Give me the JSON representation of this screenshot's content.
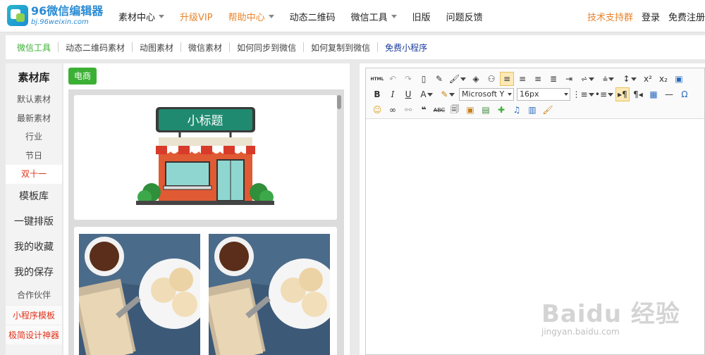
{
  "logo": {
    "title": "96微信编辑器",
    "subtitle": "bj.96weixin.com"
  },
  "topnav": {
    "items": [
      {
        "label": "素材中心",
        "dropdown": true,
        "color": "#222222"
      },
      {
        "label": "升级VIP",
        "dropdown": false,
        "color": "#e8842c"
      },
      {
        "label": "帮助中心",
        "dropdown": true,
        "color": "#e8842c"
      },
      {
        "label": "动态二维码",
        "dropdown": false,
        "color": "#222222"
      },
      {
        "label": "微信工具",
        "dropdown": true,
        "color": "#222222"
      },
      {
        "label": "旧版",
        "dropdown": false,
        "color": "#222222"
      },
      {
        "label": "问题反馈",
        "dropdown": false,
        "color": "#222222"
      }
    ],
    "right": {
      "support": "技术支持群",
      "login": "登录",
      "register": "免费注册"
    }
  },
  "subnav": {
    "items": [
      {
        "label": "微信工具",
        "color": "#3cb034"
      },
      {
        "label": "动态二维码素材",
        "color": "#444444"
      },
      {
        "label": "动图素材",
        "color": "#444444"
      },
      {
        "label": "微信素材",
        "color": "#444444"
      },
      {
        "label": "如何同步到微信",
        "color": "#444444"
      },
      {
        "label": "如何复制到微信",
        "color": "#444444"
      },
      {
        "label": "免费小程序",
        "color": "#1a3b9c"
      }
    ]
  },
  "sidebar": {
    "header": "素材库",
    "sub_items": [
      "默认素材",
      "最新素材",
      "行业",
      "节日",
      "双十一"
    ],
    "active_sub": "双十一",
    "main_items": [
      "模板库",
      "一键排版",
      "我的收藏",
      "我的保存"
    ],
    "small_item": "合作伙伴",
    "red_items": [
      "小程序模板",
      "极简设计神器"
    ]
  },
  "material": {
    "tag": "电商",
    "card_title": "小标题"
  },
  "editor": {
    "font_family": "Microsoft Y",
    "font_size": "16px",
    "html_label": "HTML"
  },
  "watermark": {
    "brand": "Baidu 经验",
    "url": "jingyan.baidu.com"
  }
}
